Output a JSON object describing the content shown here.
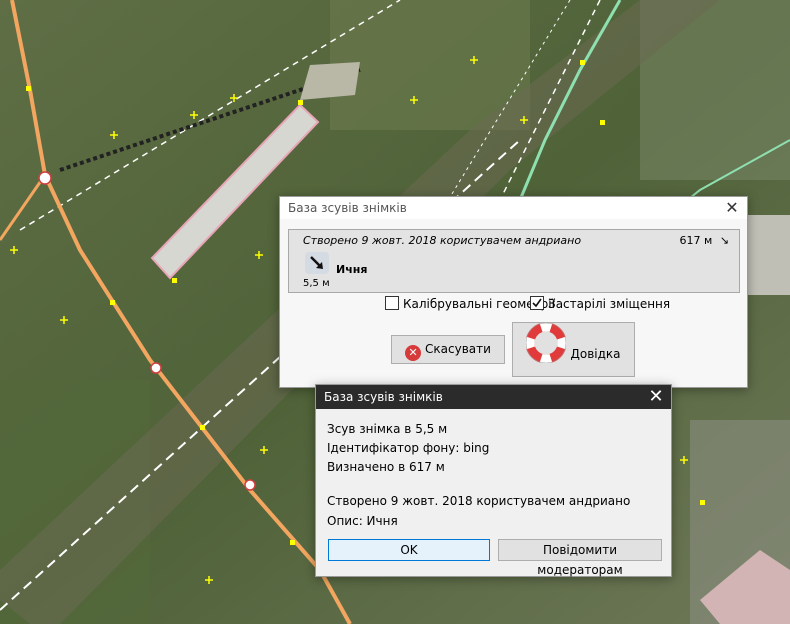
{
  "dialog_main": {
    "title": "База зсувів знімків",
    "entry": {
      "created": "Створено 9 жовт. 2018 користувачем андриано",
      "distance": "617 м",
      "name": "Ичня",
      "offset": "5,5 м"
    },
    "checkbox_calibration": {
      "label": "Калібрувальні геометрії",
      "checked": false
    },
    "checkbox_deprecated": {
      "label": "Застарілі зміщення",
      "checked": true
    },
    "cancel_label": "Скасувати",
    "help_label": "Довідка"
  },
  "dialog_info": {
    "title": "База зсувів знімків",
    "lines": [
      "Зсув знімка в 5,5 м",
      "Ідентифікатор фону: bing",
      "Визначено в 617 м",
      "Створено 9 жовт. 2018 користувачем андриано",
      "Опис: Ичня"
    ],
    "ok_label": "OK",
    "report_label": "Повідомити модераторам"
  },
  "colors": {
    "road_major": "#f3a65f",
    "road_minor": "#ffffff",
    "path_green": "#8fe0b0",
    "building": "#e8a6b8",
    "node": "#ffff00"
  }
}
